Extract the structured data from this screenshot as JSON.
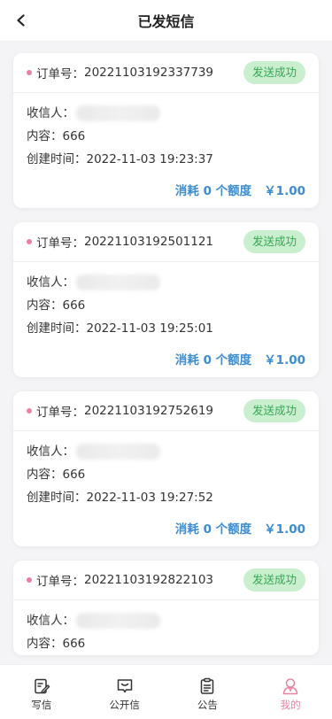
{
  "header": {
    "title": "已发短信"
  },
  "orders": [
    {
      "order_label": "订单号：",
      "order_no": "20221103192337739",
      "status": "发送成功",
      "recipient_label": "收信人：",
      "content_label": "内容：",
      "content": "666",
      "time_label": "创建时间：",
      "time": "2022-11-03 19:23:37",
      "cost": "消耗 0 个额度",
      "price": "￥1.00"
    },
    {
      "order_label": "订单号：",
      "order_no": "20221103192501121",
      "status": "发送成功",
      "recipient_label": "收信人：",
      "content_label": "内容：",
      "content": "666",
      "time_label": "创建时间：",
      "time": "2022-11-03 19:25:01",
      "cost": "消耗 0 个额度",
      "price": "￥1.00"
    },
    {
      "order_label": "订单号：",
      "order_no": "20221103192752619",
      "status": "发送成功",
      "recipient_label": "收信人：",
      "content_label": "内容：",
      "content": "666",
      "time_label": "创建时间：",
      "time": "2022-11-03 19:27:52",
      "cost": "消耗 0 个额度",
      "price": "￥1.00"
    },
    {
      "order_label": "订单号：",
      "order_no": "20221103192822103",
      "status": "发送成功",
      "recipient_label": "收信人：",
      "content_label": "内容：",
      "content": "666"
    }
  ],
  "tabs": [
    {
      "label": "写信",
      "icon": "edit-icon",
      "active": false
    },
    {
      "label": "公开信",
      "icon": "message-icon",
      "active": false
    },
    {
      "label": "公告",
      "icon": "clipboard-icon",
      "active": false
    },
    {
      "label": "我的",
      "icon": "user-icon",
      "active": true
    }
  ],
  "colors": {
    "accent_pink": "#e8829e",
    "status_green": "#34a853",
    "status_bg": "#c9efcf",
    "cost_blue": "#3d8bd1"
  }
}
